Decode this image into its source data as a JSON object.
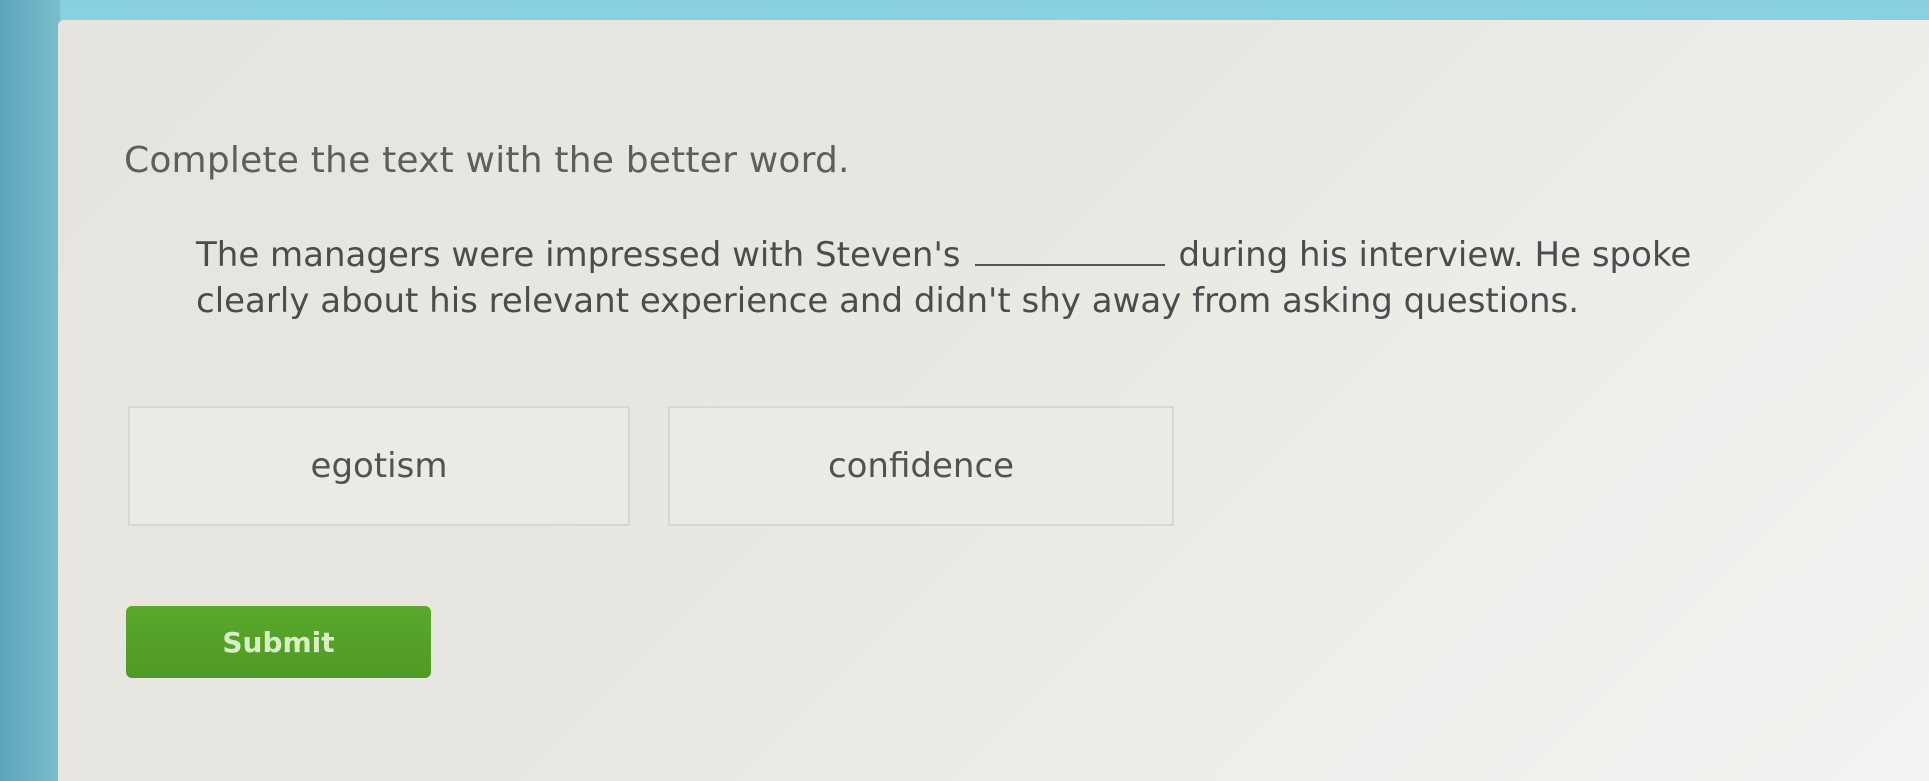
{
  "question": {
    "instruction": "Complete the text with the better word.",
    "passage_before": "The managers were impressed with Steven's",
    "passage_after": "during his interview. He spoke clearly about his relevant experience and didn't shy away from asking questions."
  },
  "choices": [
    {
      "label": "egotism"
    },
    {
      "label": "confidence"
    }
  ],
  "actions": {
    "submit_label": "Submit"
  },
  "colors": {
    "submit_green": "#55a128",
    "background_blue": "#7fc6d8",
    "panel": "#e9e7e1"
  }
}
